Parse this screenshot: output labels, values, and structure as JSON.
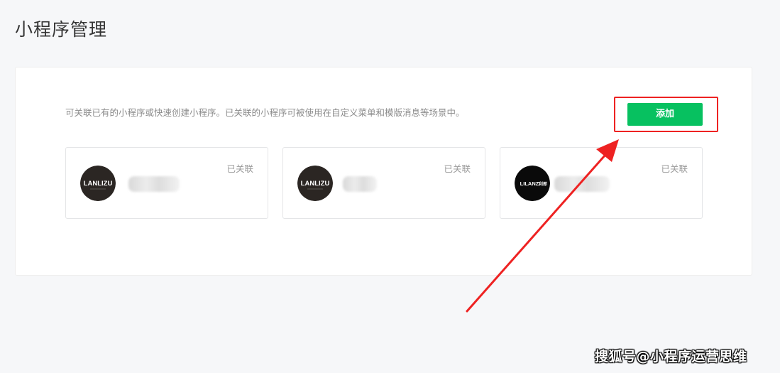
{
  "page": {
    "title": "小程序管理"
  },
  "panel": {
    "description": "可关联已有的小程序或快速创建小程序。已关联的小程序可被使用在自定义菜单和模版消息等场景中。",
    "add_label": "添加"
  },
  "mini_programs": [
    {
      "logo_text": "LANLIZU",
      "status": "已关联",
      "logo_icon": "lanlizu-logo-icon"
    },
    {
      "logo_text": "LANLIZU",
      "status": "已关联",
      "logo_icon": "lanlizu-logo-icon"
    },
    {
      "logo_text": "LILANZ",
      "logo_text_extra": "利郎",
      "status": "已关联",
      "logo_icon": "lilanz-logo-icon"
    }
  ],
  "watermark": "搜狐号@小程序运营思维",
  "colors": {
    "accent_green": "#07c160",
    "highlight_red": "#ee2222",
    "page_bg": "#f6f7f9"
  }
}
